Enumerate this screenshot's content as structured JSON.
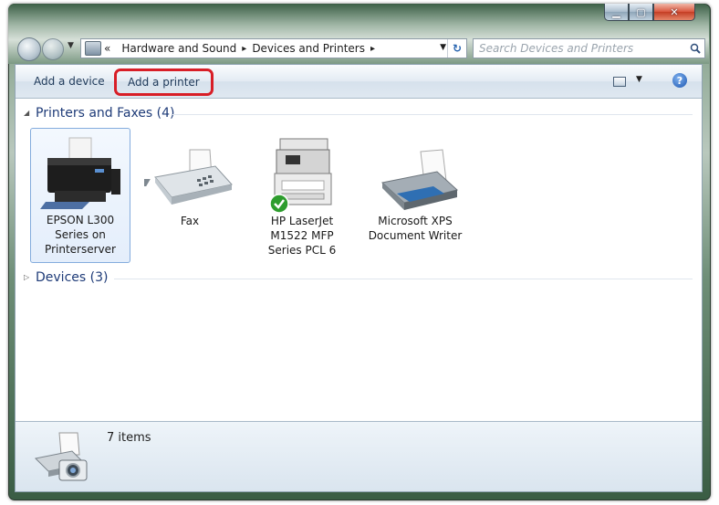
{
  "window": {
    "caption_buttons": [
      "minimize",
      "maximize",
      "close"
    ]
  },
  "address_bar": {
    "overflow": "«",
    "crumbs": [
      "Hardware and Sound",
      "Devices and Printers"
    ],
    "separator": "▸",
    "search_placeholder": "Search Devices and Printers"
  },
  "toolbar": {
    "add_device": "Add a device",
    "add_printer": "Add a printer",
    "help": "?"
  },
  "groups": {
    "printers": {
      "title": "Printers and Faxes (4)",
      "items": [
        {
          "label": "EPSON L300 Series on Printerserver",
          "line1": "EPSON L300",
          "line2": "Series on",
          "line3": "Printerserver",
          "icon": "inkjet-printer-icon"
        },
        {
          "label": "Fax",
          "line1": "Fax",
          "icon": "fax-icon"
        },
        {
          "label": "HP LaserJet M1522 MFP Series PCL 6",
          "line1": "HP LaserJet",
          "line2": "M1522 MFP",
          "line3": "Series PCL 6",
          "icon": "mfp-printer-icon",
          "default": true
        },
        {
          "label": "Microsoft XPS Document Writer",
          "line1": "Microsoft XPS",
          "line2": "Document Writer",
          "icon": "xps-printer-icon"
        }
      ]
    },
    "devices": {
      "title": "Devices (3)"
    }
  },
  "status": {
    "text": "7 items"
  },
  "colors": {
    "highlight_red": "#d81e27",
    "group_title": "#1e3b78",
    "default_check": "#2e9d2e"
  }
}
